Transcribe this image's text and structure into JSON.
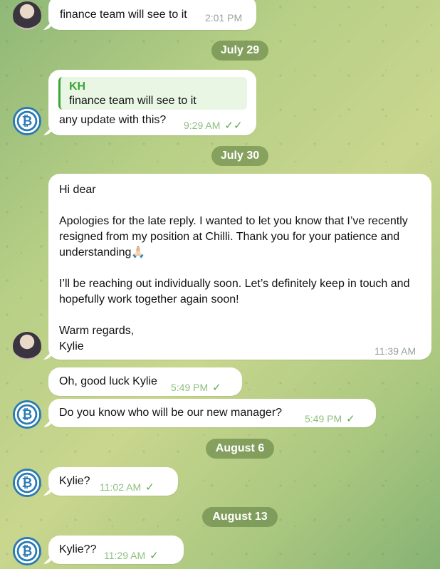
{
  "messages": {
    "m1": {
      "text": "finance team will see to it",
      "time": "2:01 PM"
    },
    "date1": "July 29",
    "m2": {
      "quote_name": "KH",
      "quote_text": "finance team will see to it",
      "text": "any update with this?",
      "time": "9:29 AM",
      "status": "✓✓"
    },
    "date2": "July 30",
    "m3": {
      "greeting": "Hi dear",
      "p1": "Apologies for the late reply. I wanted to let you know that I’ve recently resigned from my position at Chilli. Thank you for your patience and understanding",
      "emoji": "🙏🏻",
      "p2": "I’ll be reaching out individually soon. Let’s definitely keep in touch and hopefully work together again soon!",
      "sign1": "Warm regards,",
      "sign2": "Kylie",
      "time": "11:39 AM"
    },
    "m4": {
      "text": "Oh, good luck Kylie",
      "time": "5:49 PM",
      "status": "✓"
    },
    "m5": {
      "text": "Do you know who will be our new manager?",
      "time": "5:49 PM",
      "status": "✓"
    },
    "date3": "August 6",
    "m6": {
      "text": "Kylie?",
      "time": "11:02 AM",
      "status": "✓"
    },
    "date4": "August 13",
    "m7": {
      "text": "Kylie??",
      "time": "11:29 AM",
      "status": "✓"
    }
  },
  "colors": {
    "accent": "#3aa53a",
    "time": "#8fbf7f",
    "check": "#5cab4e",
    "coin": "#2a7bb4"
  },
  "icons": {
    "sender_avatar": "profile-photo",
    "self_avatar": "bitcoin-coin-logo",
    "read": "double-check",
    "sent": "single-check"
  }
}
